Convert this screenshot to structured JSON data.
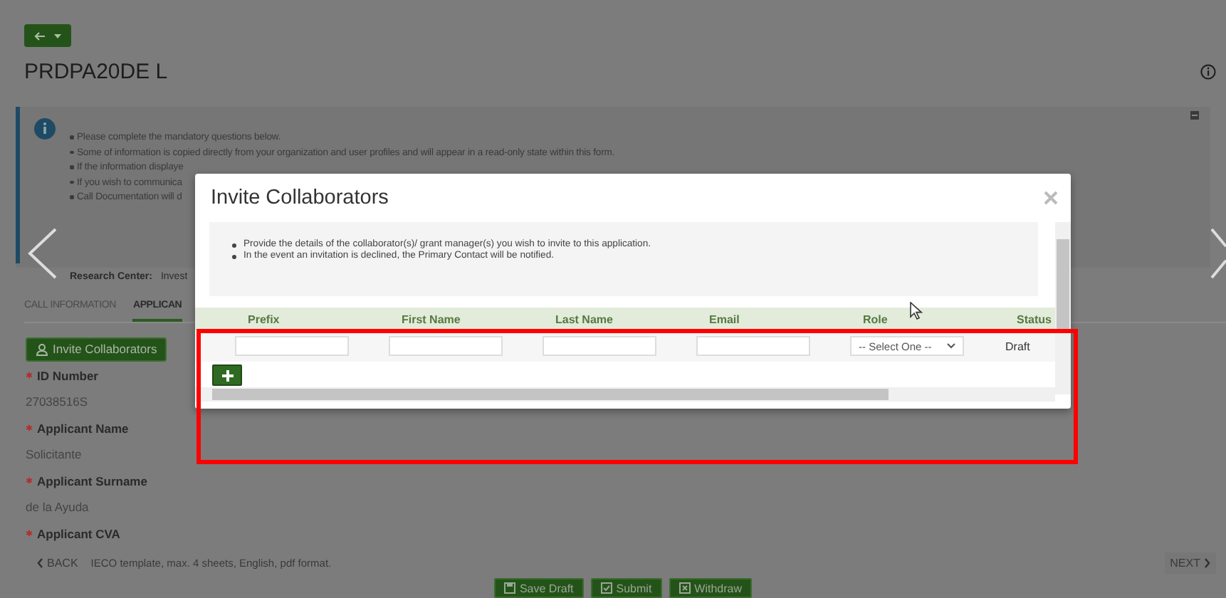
{
  "page": {
    "title": "PRDPA20DE L",
    "notice": [
      "Please complete the mandatory questions below.",
      "Some of information is copied directly from your organization and user profiles and will appear in a read-only state within this form.",
      "If the information displaye",
      "If you wish to communica",
      "Call Documentation will d"
    ],
    "research_center": {
      "label": "Research Center:",
      "value": "Invest"
    },
    "tabs": [
      {
        "label": "CALL INFORMATION",
        "selected": false
      },
      {
        "label": "APPLICAN",
        "selected": true
      }
    ],
    "invite_button": "Invite Collaborators",
    "fields": [
      {
        "label": "ID Number",
        "required": true,
        "value": "27038516S"
      },
      {
        "label": "Applicant Name",
        "required": true,
        "value": "Solicitante"
      },
      {
        "label": "Applicant Surname",
        "required": true,
        "value": "de la Ayuda"
      },
      {
        "label": "Applicant CVA",
        "required": true
      }
    ],
    "back": "BACK",
    "hint": "IECO template, max. 4 sheets, English, pdf format.",
    "next": "NEXT",
    "actions": [
      {
        "kind": "save",
        "label": "Save Draft"
      },
      {
        "kind": "submit",
        "label": "Submit"
      },
      {
        "kind": "withdraw",
        "label": "Withdraw"
      }
    ]
  },
  "dialog": {
    "title": "Invite Collaborators",
    "notes": [
      "Provide the details of the collaborator(s)/ grant manager(s) you wish to invite to this application.",
      "In the event an invitation is declined, the Primary Contact will be notified."
    ],
    "columns": [
      "Prefix",
      "First Name",
      "Last Name",
      "Email",
      "Role",
      "Status"
    ],
    "rows": [
      {
        "role": {
          "placeholder": "-- Select One --"
        },
        "status": "Draft"
      }
    ]
  }
}
